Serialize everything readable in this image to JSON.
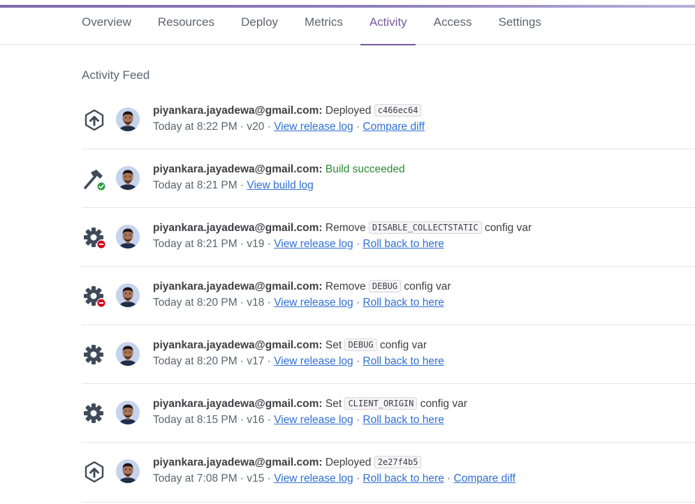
{
  "tabs": [
    {
      "label": "Overview",
      "active": false
    },
    {
      "label": "Resources",
      "active": false
    },
    {
      "label": "Deploy",
      "active": false
    },
    {
      "label": "Metrics",
      "active": false
    },
    {
      "label": "Activity",
      "active": true
    },
    {
      "label": "Access",
      "active": false
    },
    {
      "label": "Settings",
      "active": false
    }
  ],
  "feed_title": "Activity Feed",
  "colors": {
    "accent": "#79589f",
    "link": "#2f6fd1",
    "success": "#2a8b2e",
    "danger": "#d0021b"
  },
  "events": [
    {
      "icon": "deploy-icon",
      "user": "piyankara.jayadewa@gmail.com:",
      "action": "Deployed",
      "code": "c466ec64",
      "after": "",
      "time": "Today at 8:22 PM",
      "version": "v20",
      "links": [
        "View release log",
        "Compare diff"
      ]
    },
    {
      "icon": "build-hammer-icon",
      "user": "piyankara.jayadewa@gmail.com:",
      "action": "",
      "success": "Build succeeded",
      "code": "",
      "after": "",
      "time": "Today at 8:21 PM",
      "version": "",
      "links": [
        "View build log"
      ]
    },
    {
      "icon": "config-remove-icon",
      "user": "piyankara.jayadewa@gmail.com:",
      "action": "Remove",
      "code": "DISABLE_COLLECTSTATIC",
      "after": "config var",
      "time": "Today at 8:21 PM",
      "version": "v19",
      "links": [
        "View release log",
        "Roll back to here"
      ]
    },
    {
      "icon": "config-remove-icon",
      "user": "piyankara.jayadewa@gmail.com:",
      "action": "Remove",
      "code": "DEBUG",
      "after": "config var",
      "time": "Today at 8:20 PM",
      "version": "v18",
      "links": [
        "View release log",
        "Roll back to here"
      ]
    },
    {
      "icon": "gear-icon",
      "user": "piyankara.jayadewa@gmail.com:",
      "action": "Set",
      "code": "DEBUG",
      "after": "config var",
      "time": "Today at 8:20 PM",
      "version": "v17",
      "links": [
        "View release log",
        "Roll back to here"
      ]
    },
    {
      "icon": "gear-icon",
      "user": "piyankara.jayadewa@gmail.com:",
      "action": "Set",
      "code": "CLIENT_ORIGIN",
      "after": "config var",
      "time": "Today at 8:15 PM",
      "version": "v16",
      "links": [
        "View release log",
        "Roll back to here"
      ]
    },
    {
      "icon": "deploy-icon",
      "user": "piyankara.jayadewa@gmail.com:",
      "action": "Deployed",
      "code": "2e27f4b5",
      "after": "",
      "time": "Today at 7:08 PM",
      "version": "v15",
      "links": [
        "View release log",
        "Roll back to here",
        "Compare diff"
      ]
    }
  ]
}
